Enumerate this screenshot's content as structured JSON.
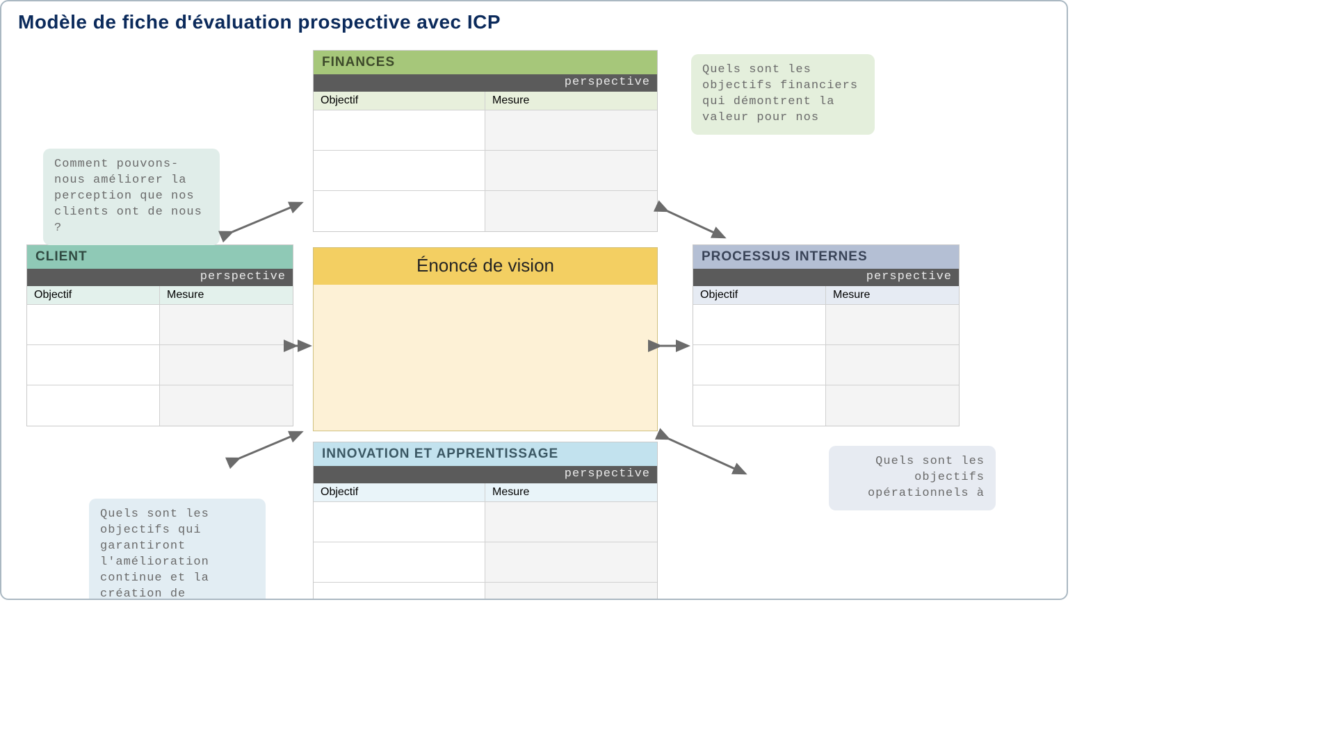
{
  "title": "Modèle de fiche d'évaluation prospective avec ICP",
  "perspective_label": "perspective",
  "col_objective": "Objectif",
  "col_measure": "Mesure",
  "vision_title": "Énoncé de vision",
  "sections": {
    "finances": {
      "title": "FINANCES"
    },
    "client": {
      "title": "CLIENT"
    },
    "process": {
      "title": "PROCESSUS INTERNES"
    },
    "innovation": {
      "title": "INNOVATION ET APPRENTISSAGE"
    }
  },
  "questions": {
    "finances": "Quels sont les objectifs financiers qui démontrent la valeur pour nos",
    "client": "Comment pouvons-nous améliorer la perception que nos clients ont de nous ?",
    "process": "Quels sont les objectifs opérationnels à",
    "innovation": "Quels sont les objectifs qui garantiront l'amélioration continue et la création de"
  }
}
